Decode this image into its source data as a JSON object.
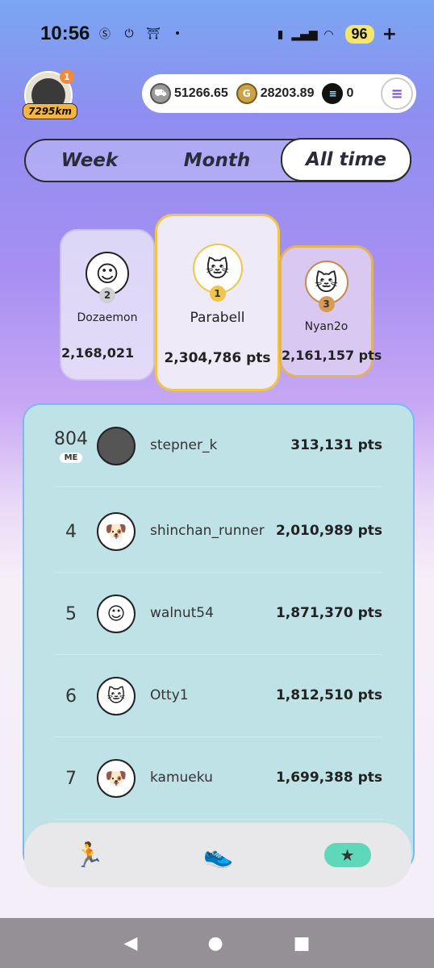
{
  "status": {
    "time": "10:56",
    "battery": "96",
    "battery_plus": "+"
  },
  "header": {
    "notifications": "1",
    "distance": "7295km",
    "wallet": {
      "gst": "51266.65",
      "gmt": "28203.89",
      "sol": "0"
    }
  },
  "tabs": [
    {
      "label": "Week"
    },
    {
      "label": "Month"
    },
    {
      "label": "All time"
    }
  ],
  "podium": {
    "second": {
      "rank": "2",
      "name": "Dozaemon",
      "pts": "2,168,021"
    },
    "first": {
      "rank": "1",
      "name": "Parabell",
      "pts": "2,304,786 pts"
    },
    "third": {
      "rank": "3",
      "name": "Nyan2o",
      "pts": "2,161,157 pts"
    }
  },
  "leaderboard": {
    "me_label": "ME",
    "rows": [
      {
        "rank": "804",
        "name": "stepner_k",
        "pts": "313,131 pts",
        "avatar": "sneaker-icon"
      },
      {
        "rank": "4",
        "name": "shinchan_runner",
        "pts": "2,010,989 pts",
        "avatar": "dog-icon"
      },
      {
        "rank": "5",
        "name": "walnut54",
        "pts": "1,871,370 pts",
        "avatar": "boy-icon"
      },
      {
        "rank": "6",
        "name": "Otty1",
        "pts": "1,812,510 pts",
        "avatar": "cat-icon"
      },
      {
        "rank": "7",
        "name": "kamueku",
        "pts": "1,699,388 pts",
        "avatar": "dog-icon"
      }
    ]
  },
  "nav": {
    "items": [
      "run-icon",
      "sneaker-icon",
      "leaderboard-icon"
    ],
    "active": "leaderboard-icon"
  },
  "colors": {
    "accent_tab": "#ffffff",
    "panel": "#bfe2e7",
    "nav_active": "#5ed8b8",
    "gold": "#f0c64a"
  }
}
